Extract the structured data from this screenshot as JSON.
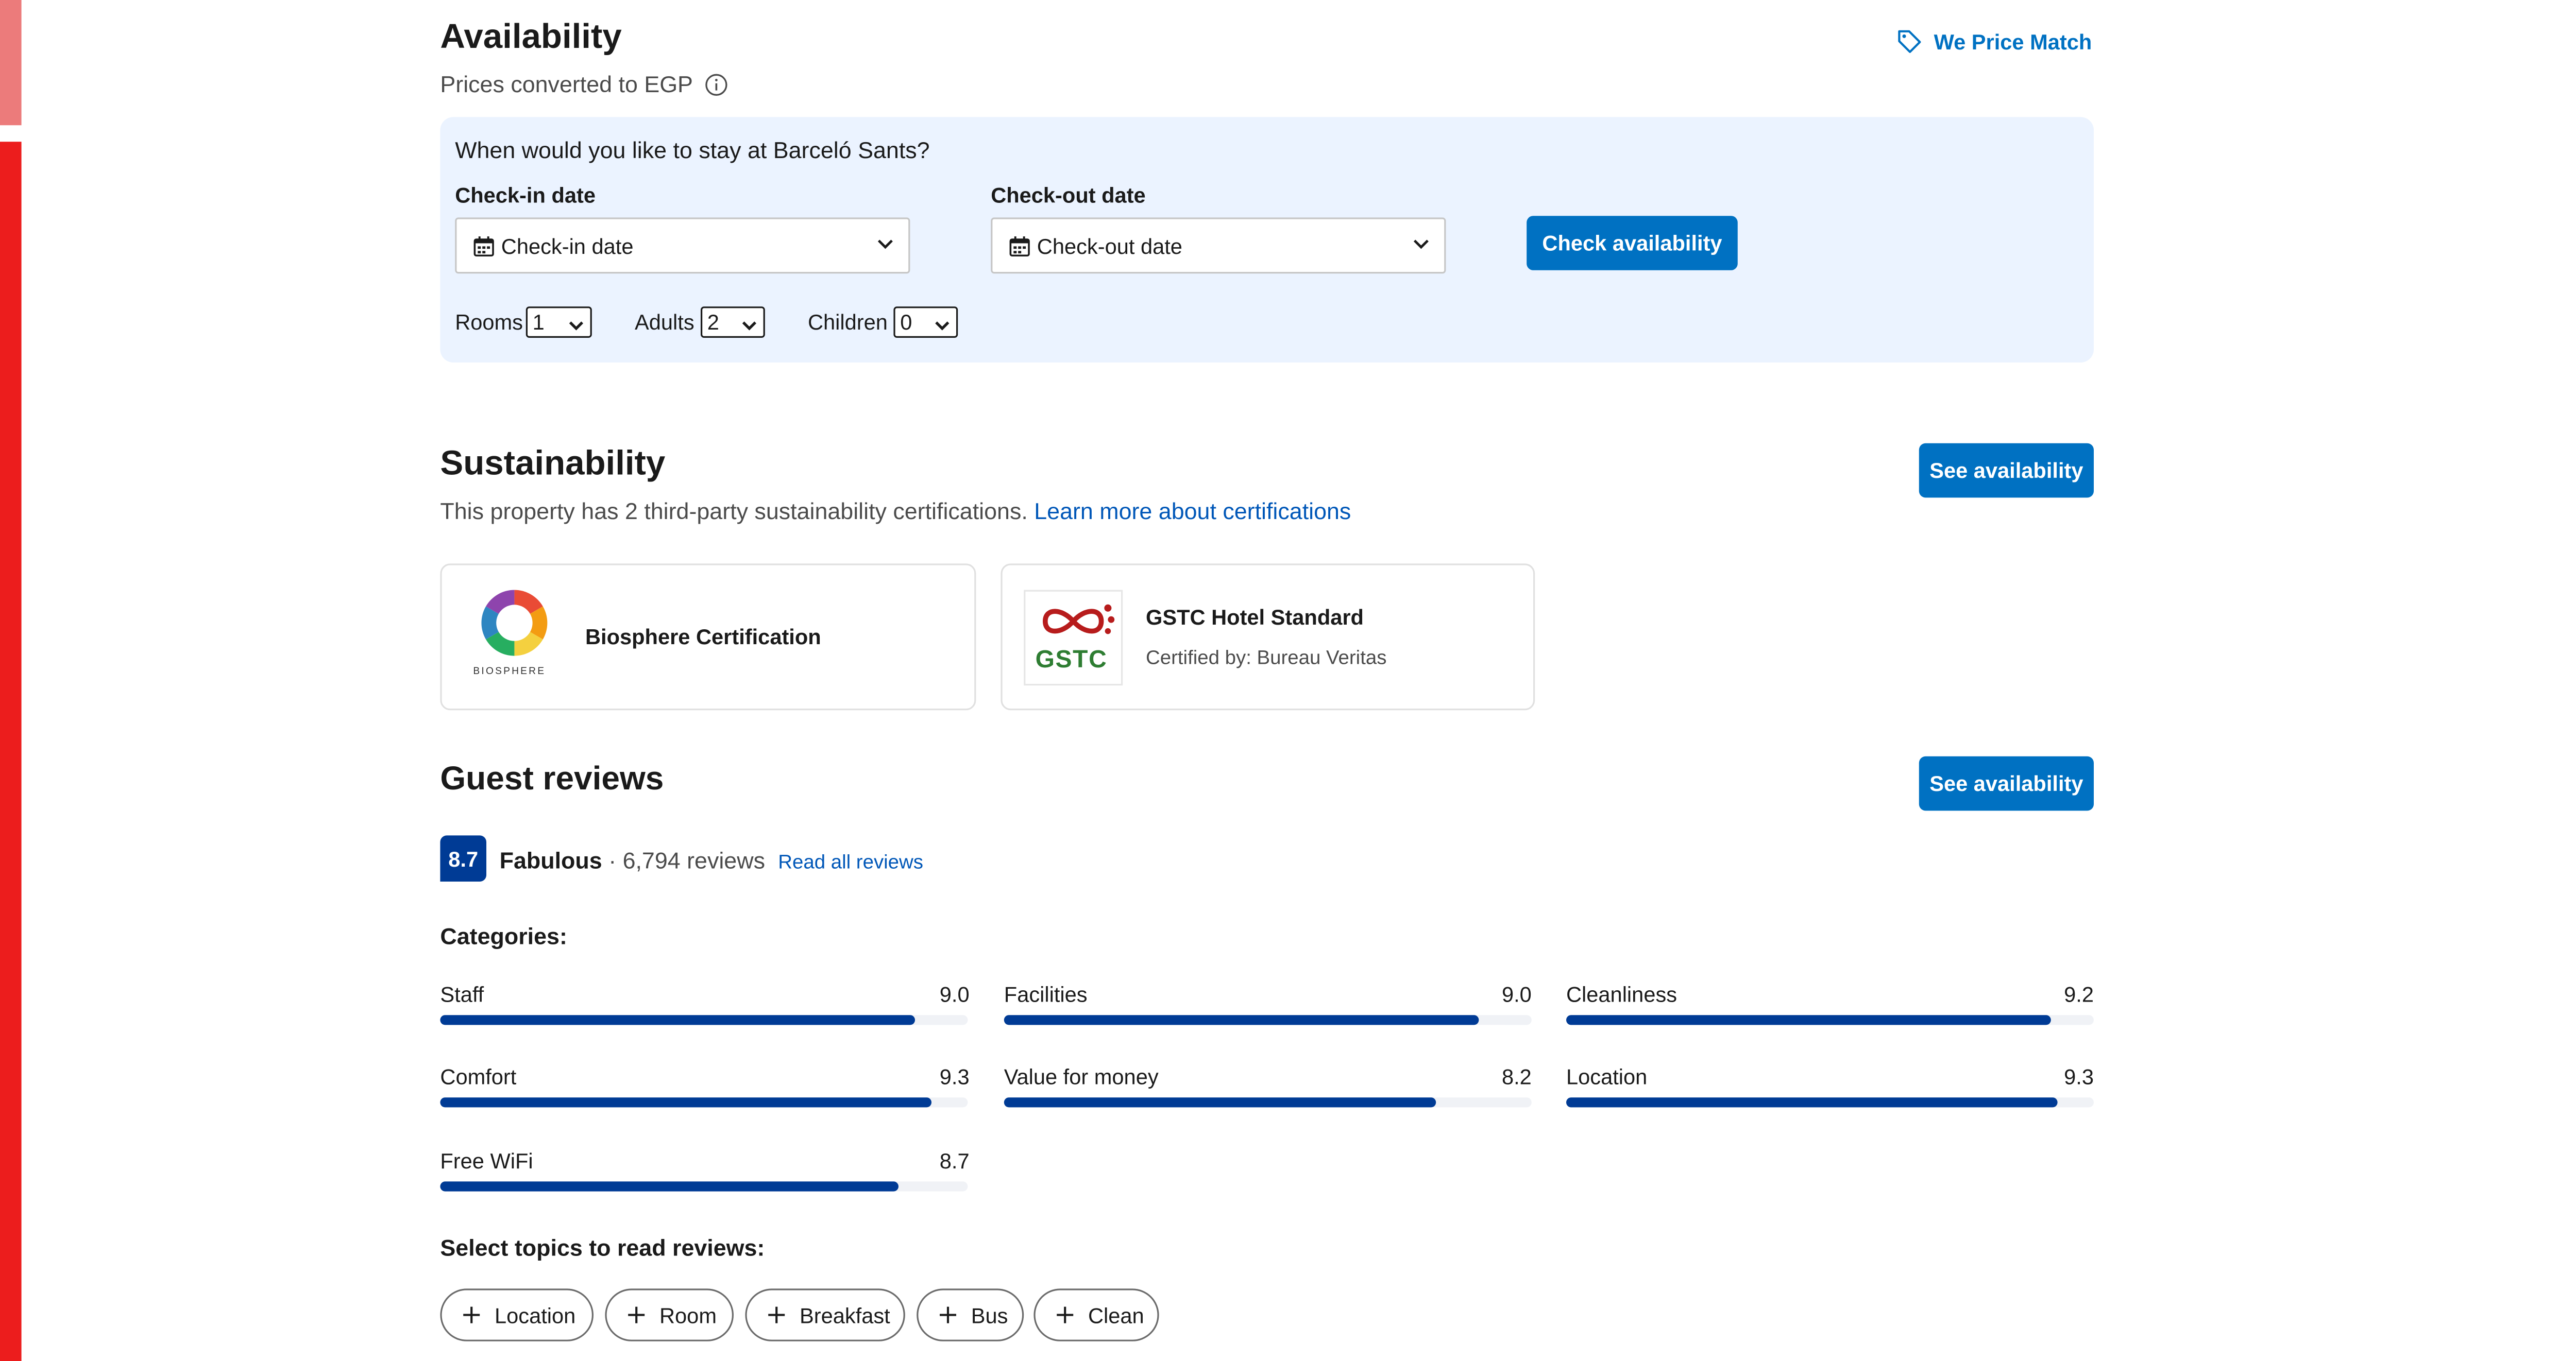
{
  "availability": {
    "title": "Availability",
    "subtitle": "Prices converted to EGP",
    "price_match": "We Price Match",
    "question": "When would you like to stay at Barceló Sants?",
    "checkin_label": "Check-in date",
    "checkin_value": "Check-in date",
    "checkout_label": "Check-out date",
    "checkout_value": "Check-out date",
    "check_button": "Check availability",
    "rooms_label": "Rooms",
    "rooms_value": "1",
    "adults_label": "Adults",
    "adults_value": "2",
    "children_label": "Children",
    "children_value": "0"
  },
  "sustainability": {
    "title": "Sustainability",
    "description": "This property has 2 third-party sustainability certifications.",
    "learn_more": "Learn more about certifications",
    "see_availability": "See availability",
    "certs": [
      {
        "name": "Biosphere Certification",
        "logo_text": "BIOSPHERE"
      },
      {
        "name": "GSTC Hotel Standard",
        "certified_by": "Certified by: Bureau Veritas",
        "logo_text": "GSTC"
      }
    ]
  },
  "reviews": {
    "title": "Guest reviews",
    "see_availability": "See availability",
    "score": "8.7",
    "rating_word": "Fabulous",
    "count_text": "· 6,794 reviews",
    "read_all": "Read all reviews",
    "categories_title": "Categories:",
    "categories": [
      {
        "label": "Staff",
        "score": "9.0",
        "value": 9.0
      },
      {
        "label": "Facilities",
        "score": "9.0",
        "value": 9.0
      },
      {
        "label": "Cleanliness",
        "score": "9.2",
        "value": 9.2
      },
      {
        "label": "Comfort",
        "score": "9.3",
        "value": 9.3
      },
      {
        "label": "Value for money",
        "score": "8.2",
        "value": 8.2
      },
      {
        "label": "Location",
        "score": "9.3",
        "value": 9.3
      },
      {
        "label": "Free WiFi",
        "score": "8.7",
        "value": 8.7
      }
    ],
    "topics_title": "Select topics to read reviews:",
    "topics": [
      "Location",
      "Room",
      "Breakfast",
      "Bus",
      "Clean"
    ]
  },
  "colors": {
    "primary": "#0071c2",
    "score_bg": "#003b95",
    "panel_bg": "#ebf3ff",
    "link": "#0057b8",
    "side_bar": "#ec1d1d"
  }
}
